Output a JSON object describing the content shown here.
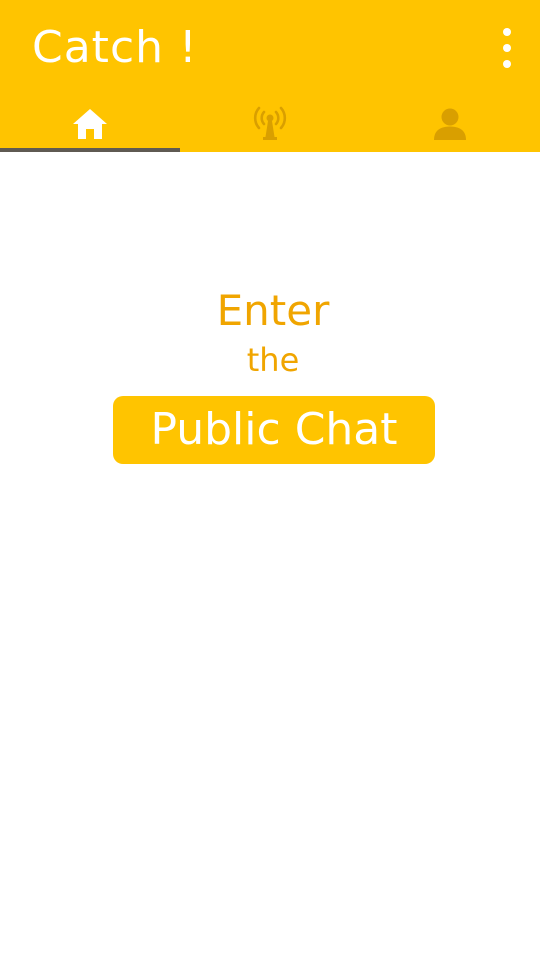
{
  "app": {
    "title": "Catch !",
    "colors": {
      "primary": "#FFC400",
      "accent_text": "#F0A500",
      "tab_indicator": "#5f5a52",
      "inactive_icon": "#D99F00",
      "background": "#ffffff"
    }
  },
  "toolbar": {
    "overflow_icon": "more-vert-icon"
  },
  "tabs": [
    {
      "icon": "home-icon",
      "selected": true
    },
    {
      "icon": "antenna-icon",
      "selected": false
    },
    {
      "icon": "person-icon",
      "selected": false
    }
  ],
  "main": {
    "line1": "Enter",
    "line2": "the",
    "button_label": "Public Chat"
  }
}
